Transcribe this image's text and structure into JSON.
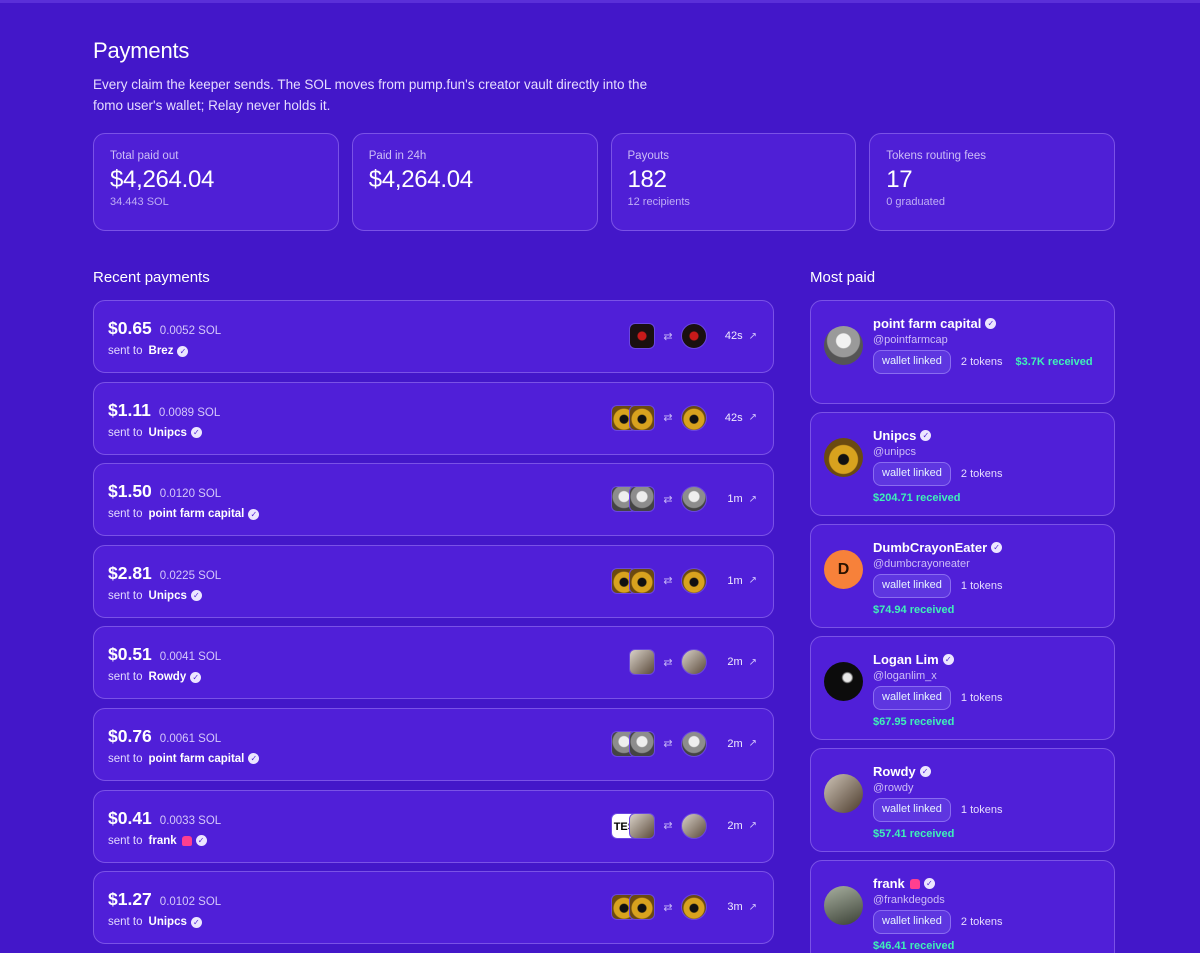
{
  "header": {
    "title": "Payments",
    "subtitle": "Every claim the keeper sends. The SOL moves from pump.fun's creator vault directly into the fomo user's wallet; Relay never holds it."
  },
  "stats": [
    {
      "label": "Total paid out",
      "value": "$4,264.04",
      "sub": "34.443 SOL"
    },
    {
      "label": "Paid in 24h",
      "value": "$4,264.04",
      "sub": ""
    },
    {
      "label": "Payouts",
      "value": "182",
      "sub": "12 recipients"
    },
    {
      "label": "Tokens routing fees",
      "value": "17",
      "sub": "0 graduated"
    }
  ],
  "recent": {
    "title": "Recent payments",
    "sent_to_label": "sent to",
    "rows": [
      {
        "usd": "$0.65",
        "sol": "0.0052 SOL",
        "name": "Brez",
        "age": "42s",
        "tokens": [
          "dark"
        ],
        "dest": "dark",
        "badge": "verified"
      },
      {
        "usd": "$1.11",
        "sol": "0.0089 SOL",
        "name": "Unipcs",
        "age": "42s",
        "tokens": [
          "bot",
          "bot"
        ],
        "dest": "bot",
        "badge": "verified"
      },
      {
        "usd": "$1.50",
        "sol": "0.0120 SOL",
        "name": "point farm capital",
        "age": "1m",
        "tokens": [
          "gray",
          "gray"
        ],
        "dest": "gray",
        "badge": "verified"
      },
      {
        "usd": "$2.81",
        "sol": "0.0225 SOL",
        "name": "Unipcs",
        "age": "1m",
        "tokens": [
          "bot",
          "bot"
        ],
        "dest": "bot",
        "badge": "verified"
      },
      {
        "usd": "$0.51",
        "sol": "0.0041 SOL",
        "name": "Rowdy",
        "age": "2m",
        "tokens": [
          "photo"
        ],
        "dest": "photo",
        "badge": "verified"
      },
      {
        "usd": "$0.76",
        "sol": "0.0061 SOL",
        "name": "point farm capital",
        "age": "2m",
        "tokens": [
          "gray",
          "gray"
        ],
        "dest": "gray",
        "badge": "verified"
      },
      {
        "usd": "$0.41",
        "sol": "0.0033 SOL",
        "name": "frank",
        "age": "2m",
        "tokens": [
          "text",
          "photo"
        ],
        "token_text": "TES",
        "dest": "photo",
        "badge": "emoji"
      },
      {
        "usd": "$1.27",
        "sol": "0.0102 SOL",
        "name": "Unipcs",
        "age": "3m",
        "tokens": [
          "bot",
          "bot"
        ],
        "dest": "bot",
        "badge": "verified"
      }
    ]
  },
  "most_paid": {
    "title": "Most paid",
    "wallet_label": "wallet linked",
    "cards": [
      {
        "name": "point farm capital",
        "handle": "@pointfarmcap",
        "tokens": "2 tokens",
        "received": "$3.7K received",
        "avatar": "gray",
        "inline": true,
        "badge": "verified"
      },
      {
        "name": "Unipcs",
        "handle": "@unipcs",
        "tokens": "2 tokens",
        "received": "$204.71 received",
        "avatar": "bot",
        "inline": false,
        "badge": "verified"
      },
      {
        "name": "DumbCrayonEater",
        "handle": "@dumbcrayoneater",
        "tokens": "1 tokens",
        "received": "$74.94 received",
        "avatar": "letter",
        "letter": "D",
        "inline": false,
        "badge": "verified"
      },
      {
        "name": "Logan Lim",
        "handle": "@loganlim_x",
        "tokens": "1 tokens",
        "received": "$67.95 received",
        "avatar": "black",
        "inline": false,
        "badge": "verified"
      },
      {
        "name": "Rowdy",
        "handle": "@rowdy",
        "tokens": "1 tokens",
        "received": "$57.41 received",
        "avatar": "photo",
        "inline": false,
        "badge": "verified"
      },
      {
        "name": "frank",
        "handle": "@frankdegods",
        "tokens": "2 tokens",
        "received": "$46.41 received",
        "avatar": "photo2",
        "inline": false,
        "badge": "emoji+verified"
      }
    ]
  },
  "icons": {
    "swap": "⇄",
    "external": "↗",
    "verified": "✓"
  }
}
